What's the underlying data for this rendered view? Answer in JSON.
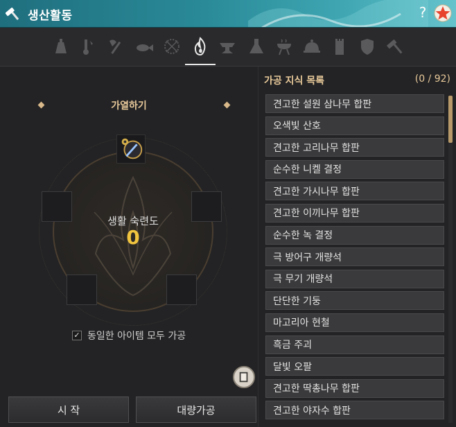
{
  "window": {
    "title": "생산활동",
    "help_glyph": "?",
    "accent_color": "#2a8a98"
  },
  "categories": [
    {
      "name": "gathering-icon",
      "active": false
    },
    {
      "name": "alchemy-tools-icon",
      "active": false
    },
    {
      "name": "axe-icon",
      "active": false
    },
    {
      "name": "fishing-icon",
      "active": false
    },
    {
      "name": "hunting-net-icon",
      "active": false
    },
    {
      "name": "heating-flame-icon",
      "active": true
    },
    {
      "name": "anvil-icon",
      "active": false
    },
    {
      "name": "flask-icon",
      "active": false
    },
    {
      "name": "grill-icon",
      "active": false
    },
    {
      "name": "cooking-cloche-icon",
      "active": false
    },
    {
      "name": "alchemy-tower-icon",
      "active": false
    },
    {
      "name": "shield-icon",
      "active": false
    },
    {
      "name": "hammer-icon",
      "active": false
    }
  ],
  "processing": {
    "mode_label": "가열하기",
    "proficiency_label": "생활 숙련도",
    "proficiency_value": "0",
    "checkbox_label": "동일한 아이템 모두 가공",
    "checkbox_checked": true,
    "check_glyph": "✓",
    "start_button": "시 작",
    "mass_button": "대량가공"
  },
  "knowledge": {
    "title": "가공 지식 목록",
    "count": "(0 / 92)",
    "items": [
      "견고한 설원 삼나무 합판",
      "오색빛 산호",
      "견고한 고리나무 합판",
      "순수한 니켈 결정",
      "견고한 가시나무 합판",
      "견고한 이끼나무 합판",
      "순수한 녹 결정",
      "극 방어구 개량석",
      "극 무기 개량석",
      "단단한 기둥",
      "마고리아 현철",
      "흑금 주괴",
      "달빛 오팔",
      "견고한 딱총나무 합판",
      "견고한 야자수 합판"
    ]
  }
}
